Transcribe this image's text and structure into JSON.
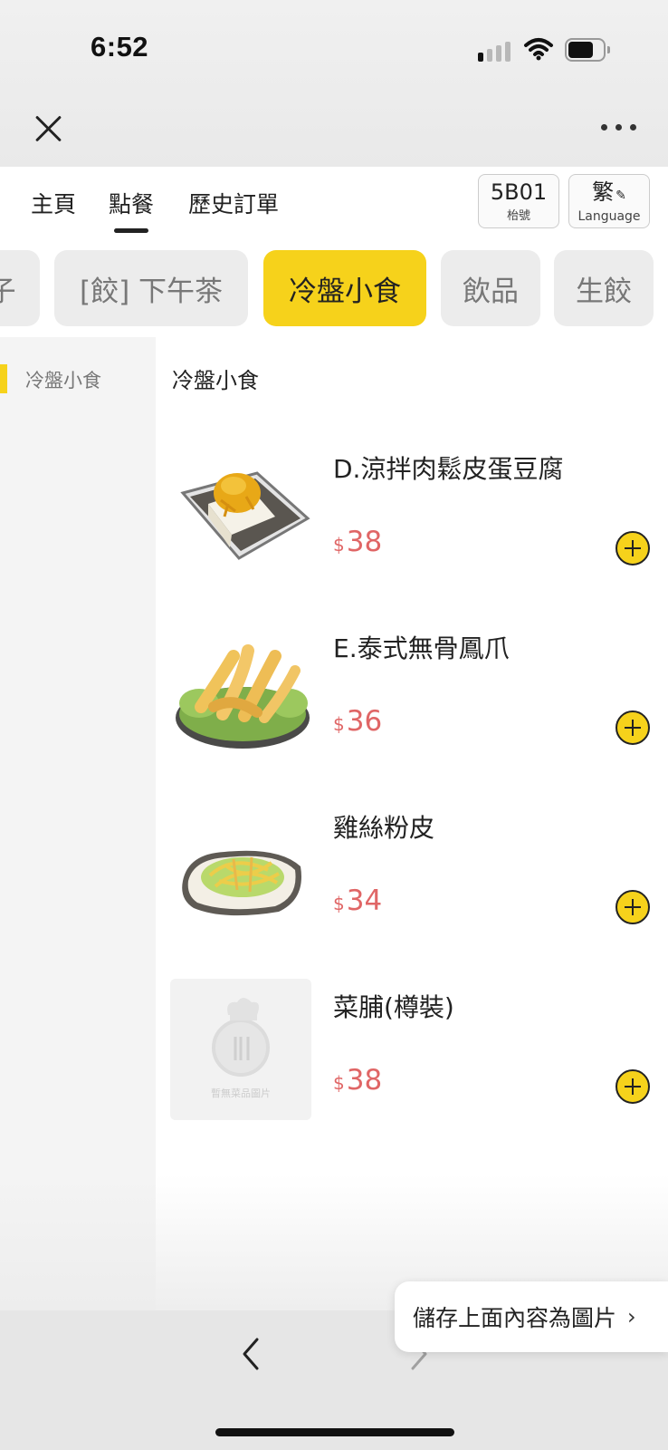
{
  "status_bar": {
    "time": "6:52"
  },
  "header": {
    "tabs": [
      {
        "label": "主頁"
      },
      {
        "label": "點餐"
      },
      {
        "label": "歷史訂單"
      }
    ],
    "table": {
      "number": "5B01",
      "caption": "枱號"
    },
    "language": {
      "current": "繁",
      "caption": "Language"
    }
  },
  "categories": [
    {
      "label": "子"
    },
    {
      "label": "[餃] 下午茶"
    },
    {
      "label": "冷盤小食"
    },
    {
      "label": "飲品"
    },
    {
      "label": "生餃"
    }
  ],
  "sidebar": {
    "items": [
      {
        "label": "冷盤小食"
      }
    ]
  },
  "section_title": "冷盤小食",
  "items": [
    {
      "name": "D.涼拌肉鬆皮蛋豆腐",
      "currency": "$",
      "price": "38",
      "image": "tofu-dish"
    },
    {
      "name": "E.泰式無骨鳳爪",
      "currency": "$",
      "price": "36",
      "image": "chicken-feet-dish"
    },
    {
      "name": "雞絲粉皮",
      "currency": "$",
      "price": "34",
      "image": "noodle-salad-dish"
    },
    {
      "name": "菜脯(樽裝)",
      "currency": "$",
      "price": "38",
      "image": "placeholder",
      "placeholder_caption": "暫無菜品圖片"
    }
  ],
  "save_toast": {
    "label": "儲存上面內容為圖片",
    "chevron": "›"
  },
  "colors": {
    "accent": "#f6d21b",
    "price": "#e06666"
  }
}
